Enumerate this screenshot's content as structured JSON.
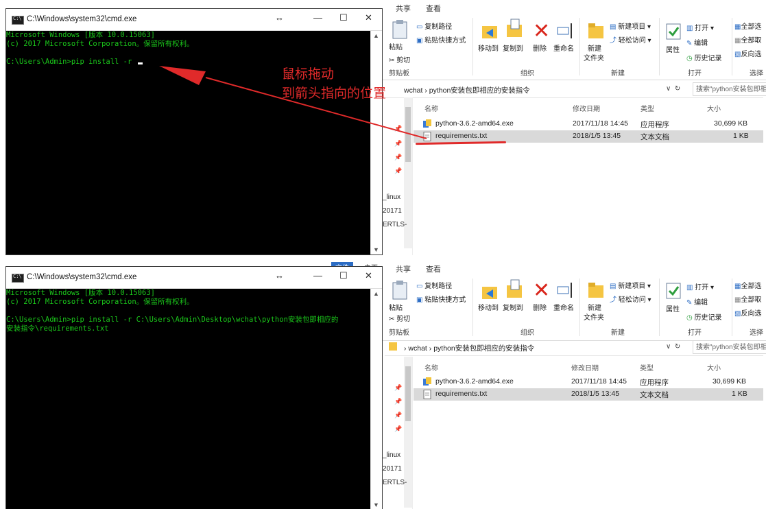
{
  "cmd": {
    "title": "C:\\Windows\\system32\\cmd.exe",
    "controls": {
      "restore": "↔",
      "minimize": "—",
      "maximize": "☐",
      "close": "✕"
    },
    "top_lines": [
      "Microsoft Windows [版本 10.0.15063]",
      "(c) 2017 Microsoft Corporation。保留所有权利。",
      "",
      "C:\\Users\\Admin>pip install -r"
    ],
    "bottom_lines": [
      "Microsoft Windows [版本 10.0.15063]",
      "(c) 2017 Microsoft Corporation。保留所有权利。",
      "",
      "C:\\Users\\Admin>pip install -r C:\\Users\\Admin\\Desktop\\wchat\\python安装包即相应的",
      "安装指令\\requirements.txt"
    ]
  },
  "annotation": {
    "line1": "鼠标拖动",
    "line2": "到箭头指向的位置",
    "color": "#e02a2a"
  },
  "explorer": {
    "tabs": {
      "share": "共享",
      "view": "查看",
      "file": "文件",
      "home": "主页"
    },
    "ribbon": {
      "copy_path": "复制路径",
      "paste_shortcut": "粘贴快捷方式",
      "paste": "粘贴",
      "cut": "剪切",
      "move_to": "移动到",
      "copy_to": "复制到",
      "delete": "删除",
      "rename": "重命名",
      "new_folder_1": "新建",
      "new_folder_2": "文件夹",
      "new_item": "新建项目 ▾",
      "easy_access": "轻松访问 ▾",
      "properties": "属性",
      "open": "打开 ▾",
      "edit": "编辑",
      "history": "历史记录",
      "select_all": "全部选",
      "select_none": "全部取",
      "invert": "反向选",
      "groups": {
        "clipboard": "剪贴板",
        "organize": "组织",
        "new": "新建",
        "open": "打开",
        "select": "选择"
      }
    },
    "address": {
      "parent": "wchat",
      "sep": "›",
      "folder": "python安装包即相应的安装指令",
      "search_placeholder": "搜索\"python安装包即相",
      "refresh": "↻",
      "dropdown": "∨"
    },
    "nav": {
      "linux": "_linux",
      "date": "20171",
      "certs": "ERTLS-"
    },
    "columns": {
      "name": "名称",
      "modified": "修改日期",
      "type": "类型",
      "size": "大小"
    },
    "files": [
      {
        "name": "python-3.6.2-amd64.exe",
        "modified": "2017/11/18 14:45",
        "type": "应用程序",
        "size": "30,699 KB"
      },
      {
        "name": "requirements.txt",
        "modified": "2018/1/5 13:45",
        "type": "文本文档",
        "size": "1 KB"
      }
    ]
  }
}
